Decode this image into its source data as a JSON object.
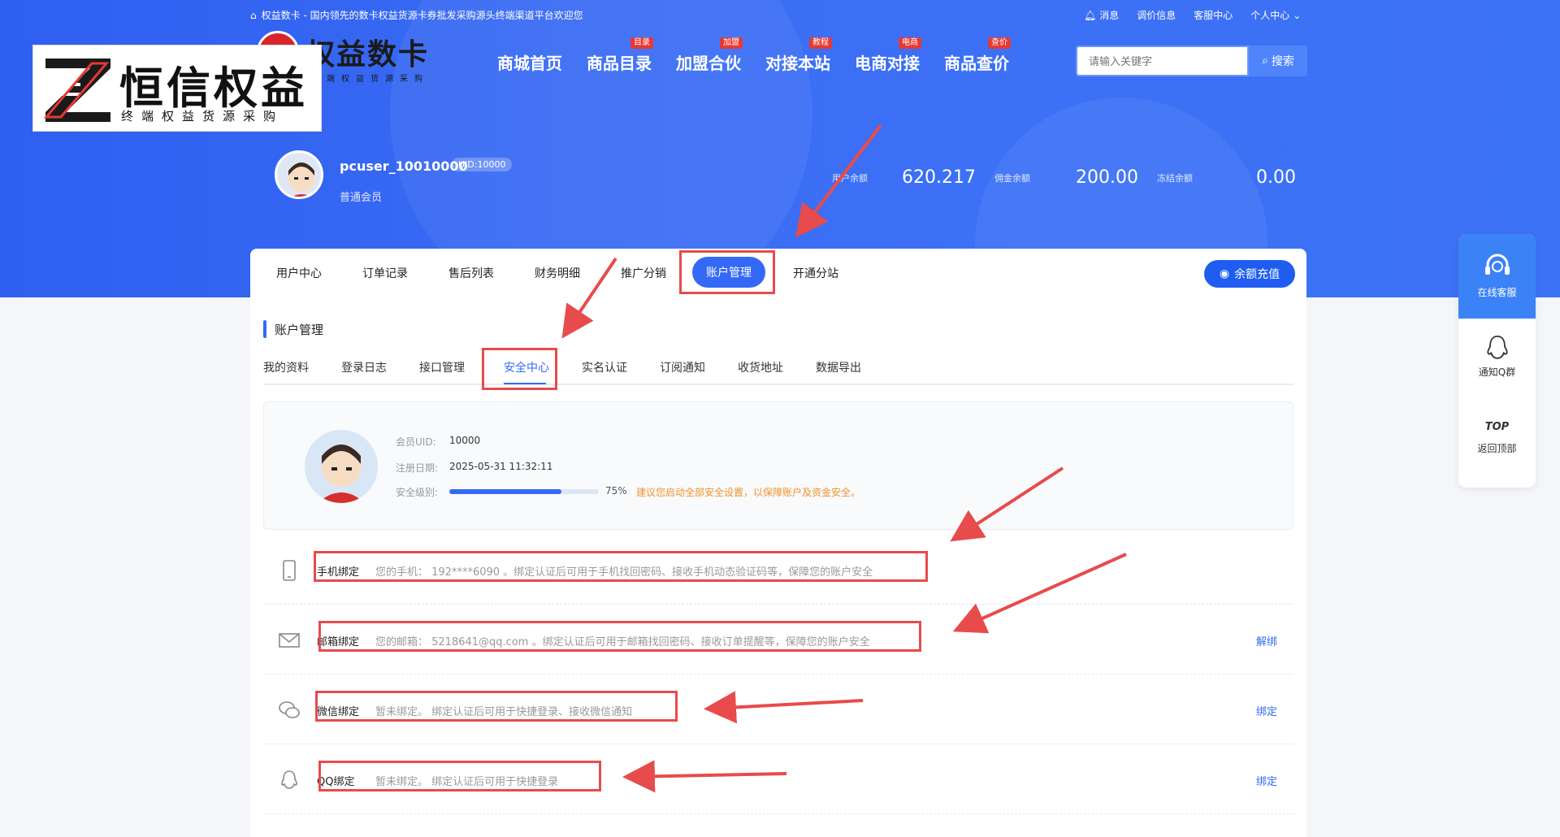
{
  "topbar": {
    "welcome": "权益数卡 - 国内领先的数卡权益货源卡券批发采购源头终端渠道平台欢迎您",
    "links": [
      "消息",
      "调价信息",
      "客服中心",
      "个人中心"
    ]
  },
  "brand": {
    "name": "权益数卡",
    "sub": "端权益货源采购"
  },
  "watermark": {
    "title": "恒信权益",
    "tagline": "终端权益货源采购",
    "letter": "Z"
  },
  "nav": [
    {
      "label": "商城首页",
      "tag": ""
    },
    {
      "label": "商品目录",
      "tag": "目录"
    },
    {
      "label": "加盟合伙",
      "tag": "加盟"
    },
    {
      "label": "对接本站",
      "tag": "教程"
    },
    {
      "label": "电商对接",
      "tag": "电商"
    },
    {
      "label": "商品查价",
      "tag": "查价"
    }
  ],
  "search": {
    "placeholder": "请输入关键字",
    "button": "搜索"
  },
  "user": {
    "name": "pcuser_10010000",
    "uid_badge": "UID:10000",
    "level": "普通会员"
  },
  "balances": [
    {
      "label": "用户余额",
      "value": "620.217"
    },
    {
      "label": "佣金余额",
      "value": "200.00"
    },
    {
      "label": "冻结余额",
      "value": "0.00"
    }
  ],
  "tabs": [
    "用户中心",
    "订单记录",
    "售后列表",
    "财务明细",
    "推广分销",
    "账户管理",
    "开通分站"
  ],
  "recharge": "余额充值",
  "section_title": "账户管理",
  "subtabs": [
    "我的资料",
    "登录日志",
    "接口管理",
    "安全中心",
    "实名认证",
    "订阅通知",
    "收货地址",
    "数据导出"
  ],
  "profile": {
    "uid_label": "会员UID:",
    "uid": "10000",
    "reg_label": "注册日期:",
    "reg": "2025-05-31 11:32:11",
    "sec_label": "安全级别:",
    "sec_pct": "75%",
    "sec_level": 0.75,
    "tip": "建议您启动全部安全设置，以保障账户及资金安全。"
  },
  "bindings": [
    {
      "title": "手机绑定",
      "desc": "您的手机： 192****6090 。绑定认证后可用于手机找回密码、接收手机动态验证码等，保障您的账户安全",
      "action": ""
    },
    {
      "title": "邮箱绑定",
      "desc": "您的邮箱： 5218641@qq.com 。绑定认证后可用于邮箱找回密码、接收订单提醒等，保障您的账户安全",
      "action": "解绑"
    },
    {
      "title": "微信绑定",
      "desc": "暂未绑定。 绑定认证后可用于快捷登录、接收微信通知",
      "action": "绑定"
    },
    {
      "title": "QQ绑定",
      "desc": "暂未绑定。 绑定认证后可用于快捷登录",
      "action": "绑定"
    }
  ],
  "float": {
    "service": "在线客服",
    "qq": "通知Q群",
    "top_icon": "TOP",
    "top": "返回顶部"
  },
  "colors": {
    "primary": "#3369f5",
    "highlight": "#e84b4b",
    "warning": "#f0932b"
  }
}
